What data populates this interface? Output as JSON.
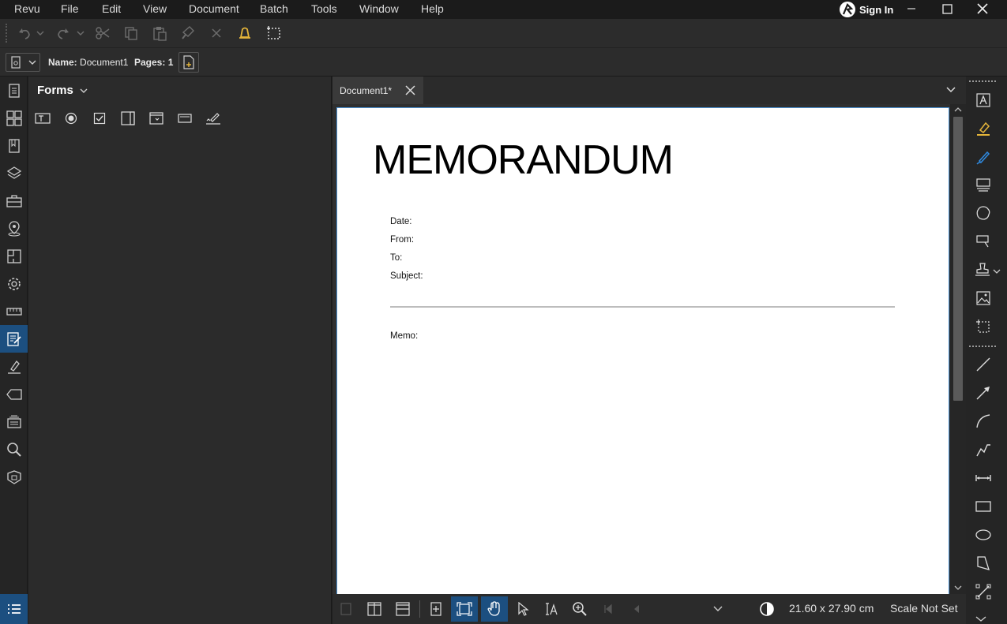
{
  "menubar": {
    "items": [
      "Revu",
      "File",
      "Edit",
      "View",
      "Document",
      "Batch",
      "Tools",
      "Window",
      "Help"
    ],
    "signin_label": "Sign In"
  },
  "toolbar": {
    "icons": [
      "undo-icon",
      "redo-icon",
      "cut-icon",
      "copy-icon",
      "paste-icon",
      "format-painter-icon",
      "delete-icon",
      "bell-icon",
      "select-area-icon"
    ]
  },
  "docbar": {
    "name_label": "Name:",
    "name_value": "Document1",
    "pages_label": "Pages:",
    "pages_value": "1"
  },
  "panel": {
    "title": "Forms",
    "tools": [
      "text-field-icon",
      "radio-button-icon",
      "checkbox-icon",
      "list-box-icon",
      "dropdown-icon",
      "button-icon",
      "signature-icon"
    ]
  },
  "document": {
    "tab_label": "Document1*",
    "title": "MEMORANDUM",
    "fields": {
      "date": "Date:",
      "from": "From:",
      "to": "To:",
      "subject": "Subject:",
      "memo": "Memo:"
    }
  },
  "statusbar": {
    "dimensions": "21.60 x 27.90 cm",
    "scale": "Scale Not Set"
  },
  "colors": {
    "accent": "#1c4f80",
    "highlight_yellow": "#e5b53a",
    "pen_blue": "#2f8ae0"
  }
}
